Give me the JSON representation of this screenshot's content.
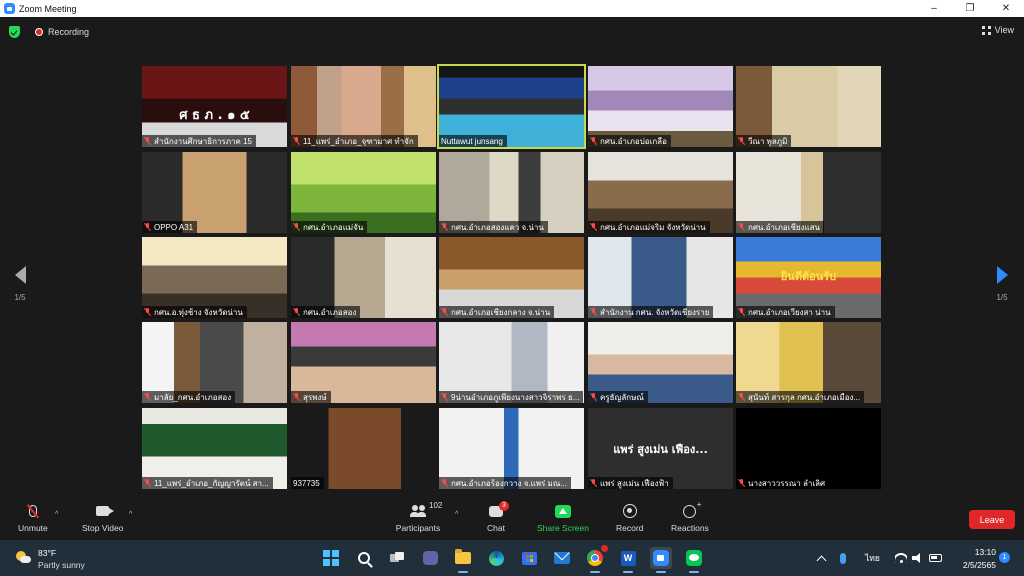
{
  "window": {
    "title": "Zoom Meeting",
    "controls": [
      "–",
      "❐",
      "✕"
    ]
  },
  "meeting": {
    "recording_label": "Recording",
    "view_label": "View",
    "page_indicator_left": "1/5",
    "page_indicator_right": "1/5",
    "overlay_text": "แพร่ สูงเม่น เฟือง..."
  },
  "tiles": [
    {
      "name": "สำนักงานศึกษาธิการภาค 15",
      "muted": true,
      "sign": "ศ ธ ภ . ๑ ๕"
    },
    {
      "name": "11_แพร่_อำเภอ_จุฑามาศ ทำจัก",
      "muted": true
    },
    {
      "name": "Nuttawut junsang",
      "muted": false,
      "active": true
    },
    {
      "name": "กศน.อำเภอบ่อเกลือ",
      "muted": true
    },
    {
      "name": "วีณา พูลภูมิ",
      "muted": true
    },
    {
      "name": "OPPO A31",
      "muted": true
    },
    {
      "name": "กศน.อำเภอแม่จัน",
      "muted": true
    },
    {
      "name": "กศน.อำเภอสองแคว จ.น่าน",
      "muted": true
    },
    {
      "name": "กศน.อำเภอแม่จริม จังหวัดน่าน",
      "muted": true
    },
    {
      "name": "กศน.อำเภอเชียงแสน",
      "muted": true
    },
    {
      "name": "กศน.อ.ทุ่งช้าง จังหวัดน่าน",
      "muted": true
    },
    {
      "name": "กศน.อำเภอสอง",
      "muted": true
    },
    {
      "name": "กศน.อำเภอเชียงกลาง จ.น่าน",
      "muted": true
    },
    {
      "name": "สำนักงาน กศน. จังหวัดเชียงราย",
      "muted": true
    },
    {
      "name": "กศน.อำเภอเวียงสา น่าน",
      "muted": true,
      "sign": "ยินดีต้อนรับ"
    },
    {
      "name": "มาลัย_กศน.อำเภอสอง",
      "muted": true
    },
    {
      "name": "สุรพงษ์",
      "muted": true
    },
    {
      "name": "9น่านอำเภอภูเพียงนางสาวจิราพร ธ...",
      "muted": true
    },
    {
      "name": "ครูธัญลักษณ์",
      "muted": true
    },
    {
      "name": "สุนันท์ สารกุล กศน.อำเภอเมือง...",
      "muted": true
    },
    {
      "name": "11_แพร่_อำเภอ_กัญญารัตน์ สา...",
      "muted": true
    },
    {
      "name": "937735",
      "muted": false
    },
    {
      "name": "กศน.อำเภอร้องกวาง จ.แพร่ มณ...",
      "muted": true
    },
    {
      "name": "แพร่ สูงเม่น เฟืองฟ้า",
      "muted": true
    },
    {
      "name": "นางสาววรรณา ลำเลิศ",
      "muted": true
    }
  ],
  "controls": {
    "unmute": "Unmute",
    "stop_video": "Stop Video",
    "participants": "Participants",
    "participants_count": "102",
    "chat": "Chat",
    "chat_badge": "3",
    "share_screen": "Share Screen",
    "record": "Record",
    "reactions": "Reactions",
    "leave": "Leave"
  },
  "taskbar": {
    "temperature": "83°F",
    "weather": "Partly sunny",
    "language": "ไทย",
    "time": "13:10",
    "date": "2/5/2565",
    "notification_count": "1",
    "word_letter": "W"
  },
  "colors": {
    "accent": "#2d8cff",
    "leave": "#e02828",
    "share": "#23d959",
    "active_speaker": "#c8d94a"
  }
}
